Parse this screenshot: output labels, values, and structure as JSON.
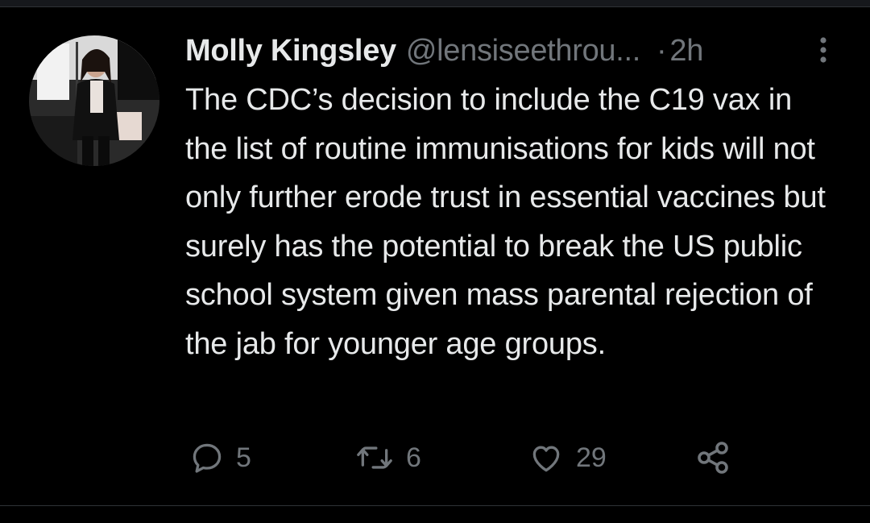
{
  "tweet": {
    "author": {
      "display_name": "Molly Kingsley",
      "handle": "@lensiseethrou...",
      "separator": "·",
      "time": "2h"
    },
    "text": "The CDC’s decision to include the C19 vax in the list of routine immunisations for kids will not only further erode trust in essential vaccines but surely has the potential to break the US public school system given mass parental rejection of the jab for younger age groups.",
    "actions": {
      "replies": "5",
      "retweets": "6",
      "likes": "29"
    }
  },
  "icons": {
    "more": "more-vertical-icon",
    "reply": "reply-icon",
    "retweet": "retweet-icon",
    "like": "heart-icon",
    "share": "share-icon"
  },
  "colors": {
    "background": "#000000",
    "text_primary": "#e7e9ea",
    "text_secondary": "#71767b",
    "divider": "#2f3336"
  }
}
